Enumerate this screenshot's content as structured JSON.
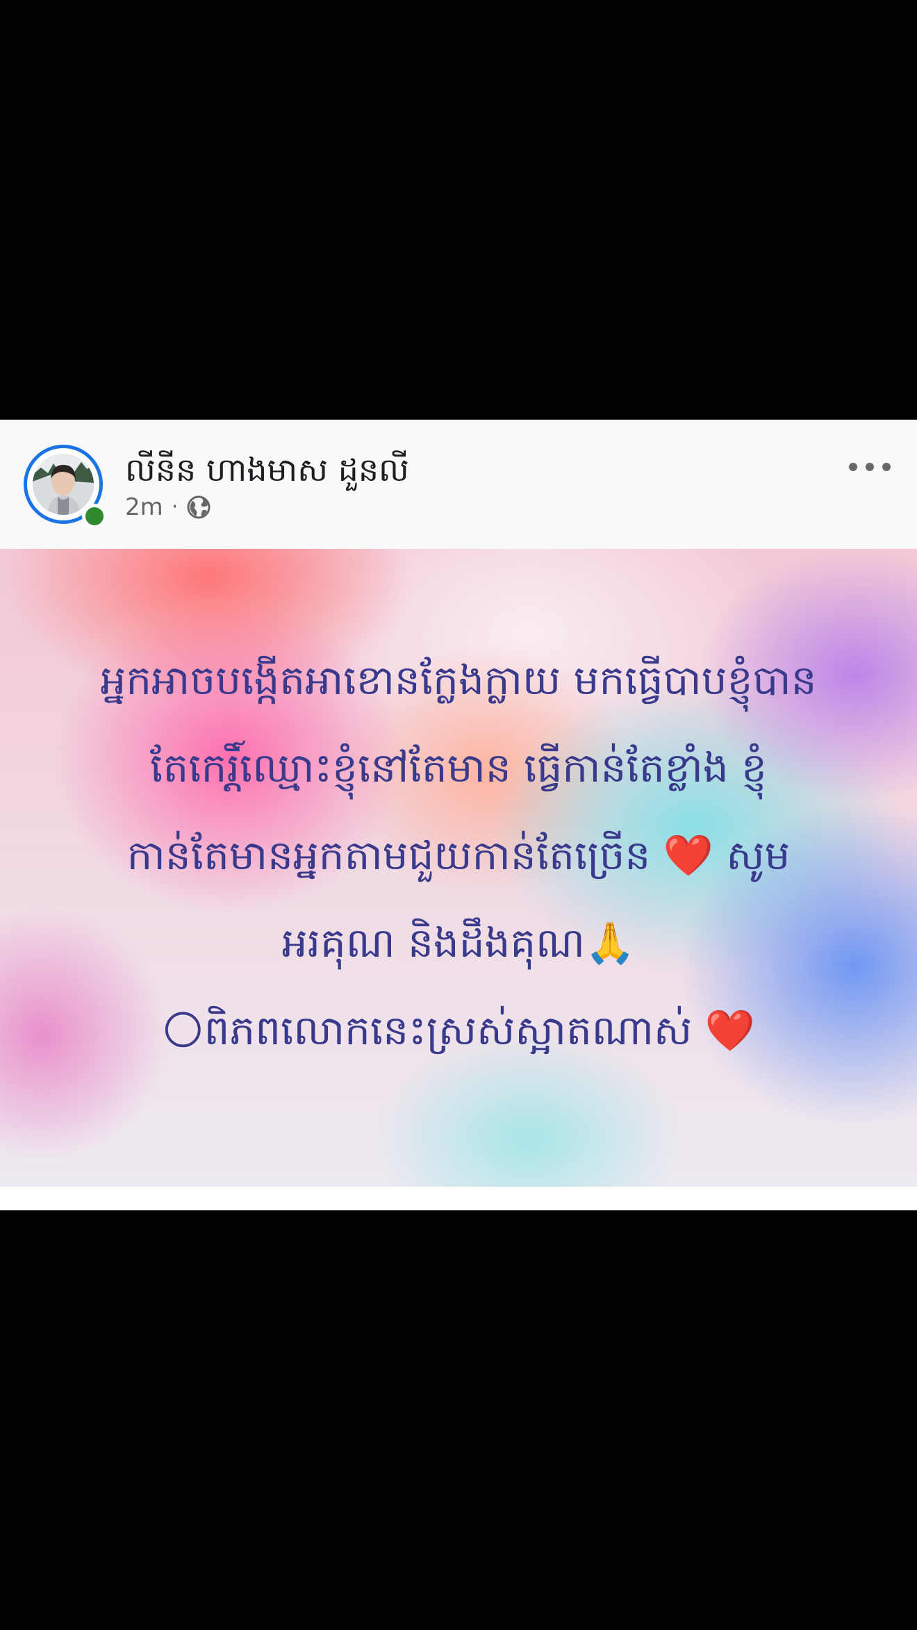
{
  "post": {
    "author": {
      "name": "លីនីន ហាងមាស ដួនលី",
      "online": true
    },
    "meta": {
      "time": "2m",
      "separator": "·",
      "audience_icon": "globe-icon"
    },
    "more_icon": "more-horizontal-icon",
    "text_lines": [
      "អ្នកអាចបង្កើតអាខោនក្លែងក្លាយ មកធ្វើបាបខ្ញុំបាន",
      "តែកេរ្តិ៍ឈ្មោះខ្ញុំនៅតែមាន ធ្វើកាន់តែខ្លាំង ខ្ញុំ",
      "កាន់តែមានអ្នកតាមជួយកាន់តែច្រើន ❤️ សូម",
      "អរគុណ និងដឹងគុណ🙏",
      "🌕ពិភពលោកនេះស្រស់ស្អាតណាស់ ❤️"
    ],
    "text_color": "#3a3a8c"
  },
  "colors": {
    "screen_background": "#000000",
    "header_background": "#f9f9fa",
    "avatar_ring": "#1b74e4",
    "online_dot": "#2e8b2e",
    "meta_text": "#65676b"
  }
}
